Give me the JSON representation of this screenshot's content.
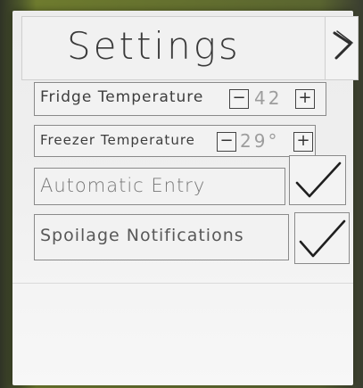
{
  "title": "Settings",
  "nav": {
    "next_icon": "chevron-right-icon"
  },
  "settings": {
    "fridge": {
      "label": "Fridge Temperature",
      "minus": "−",
      "value": "42",
      "plus": "+"
    },
    "freezer": {
      "label": "Freezer Temperature",
      "minus": "−",
      "value": "29°",
      "plus": "+"
    },
    "automatic_entry": {
      "label": "Automatic Entry",
      "checked": true
    },
    "spoilage_notifications": {
      "label": "Spoilage Notifications",
      "checked": true
    }
  }
}
